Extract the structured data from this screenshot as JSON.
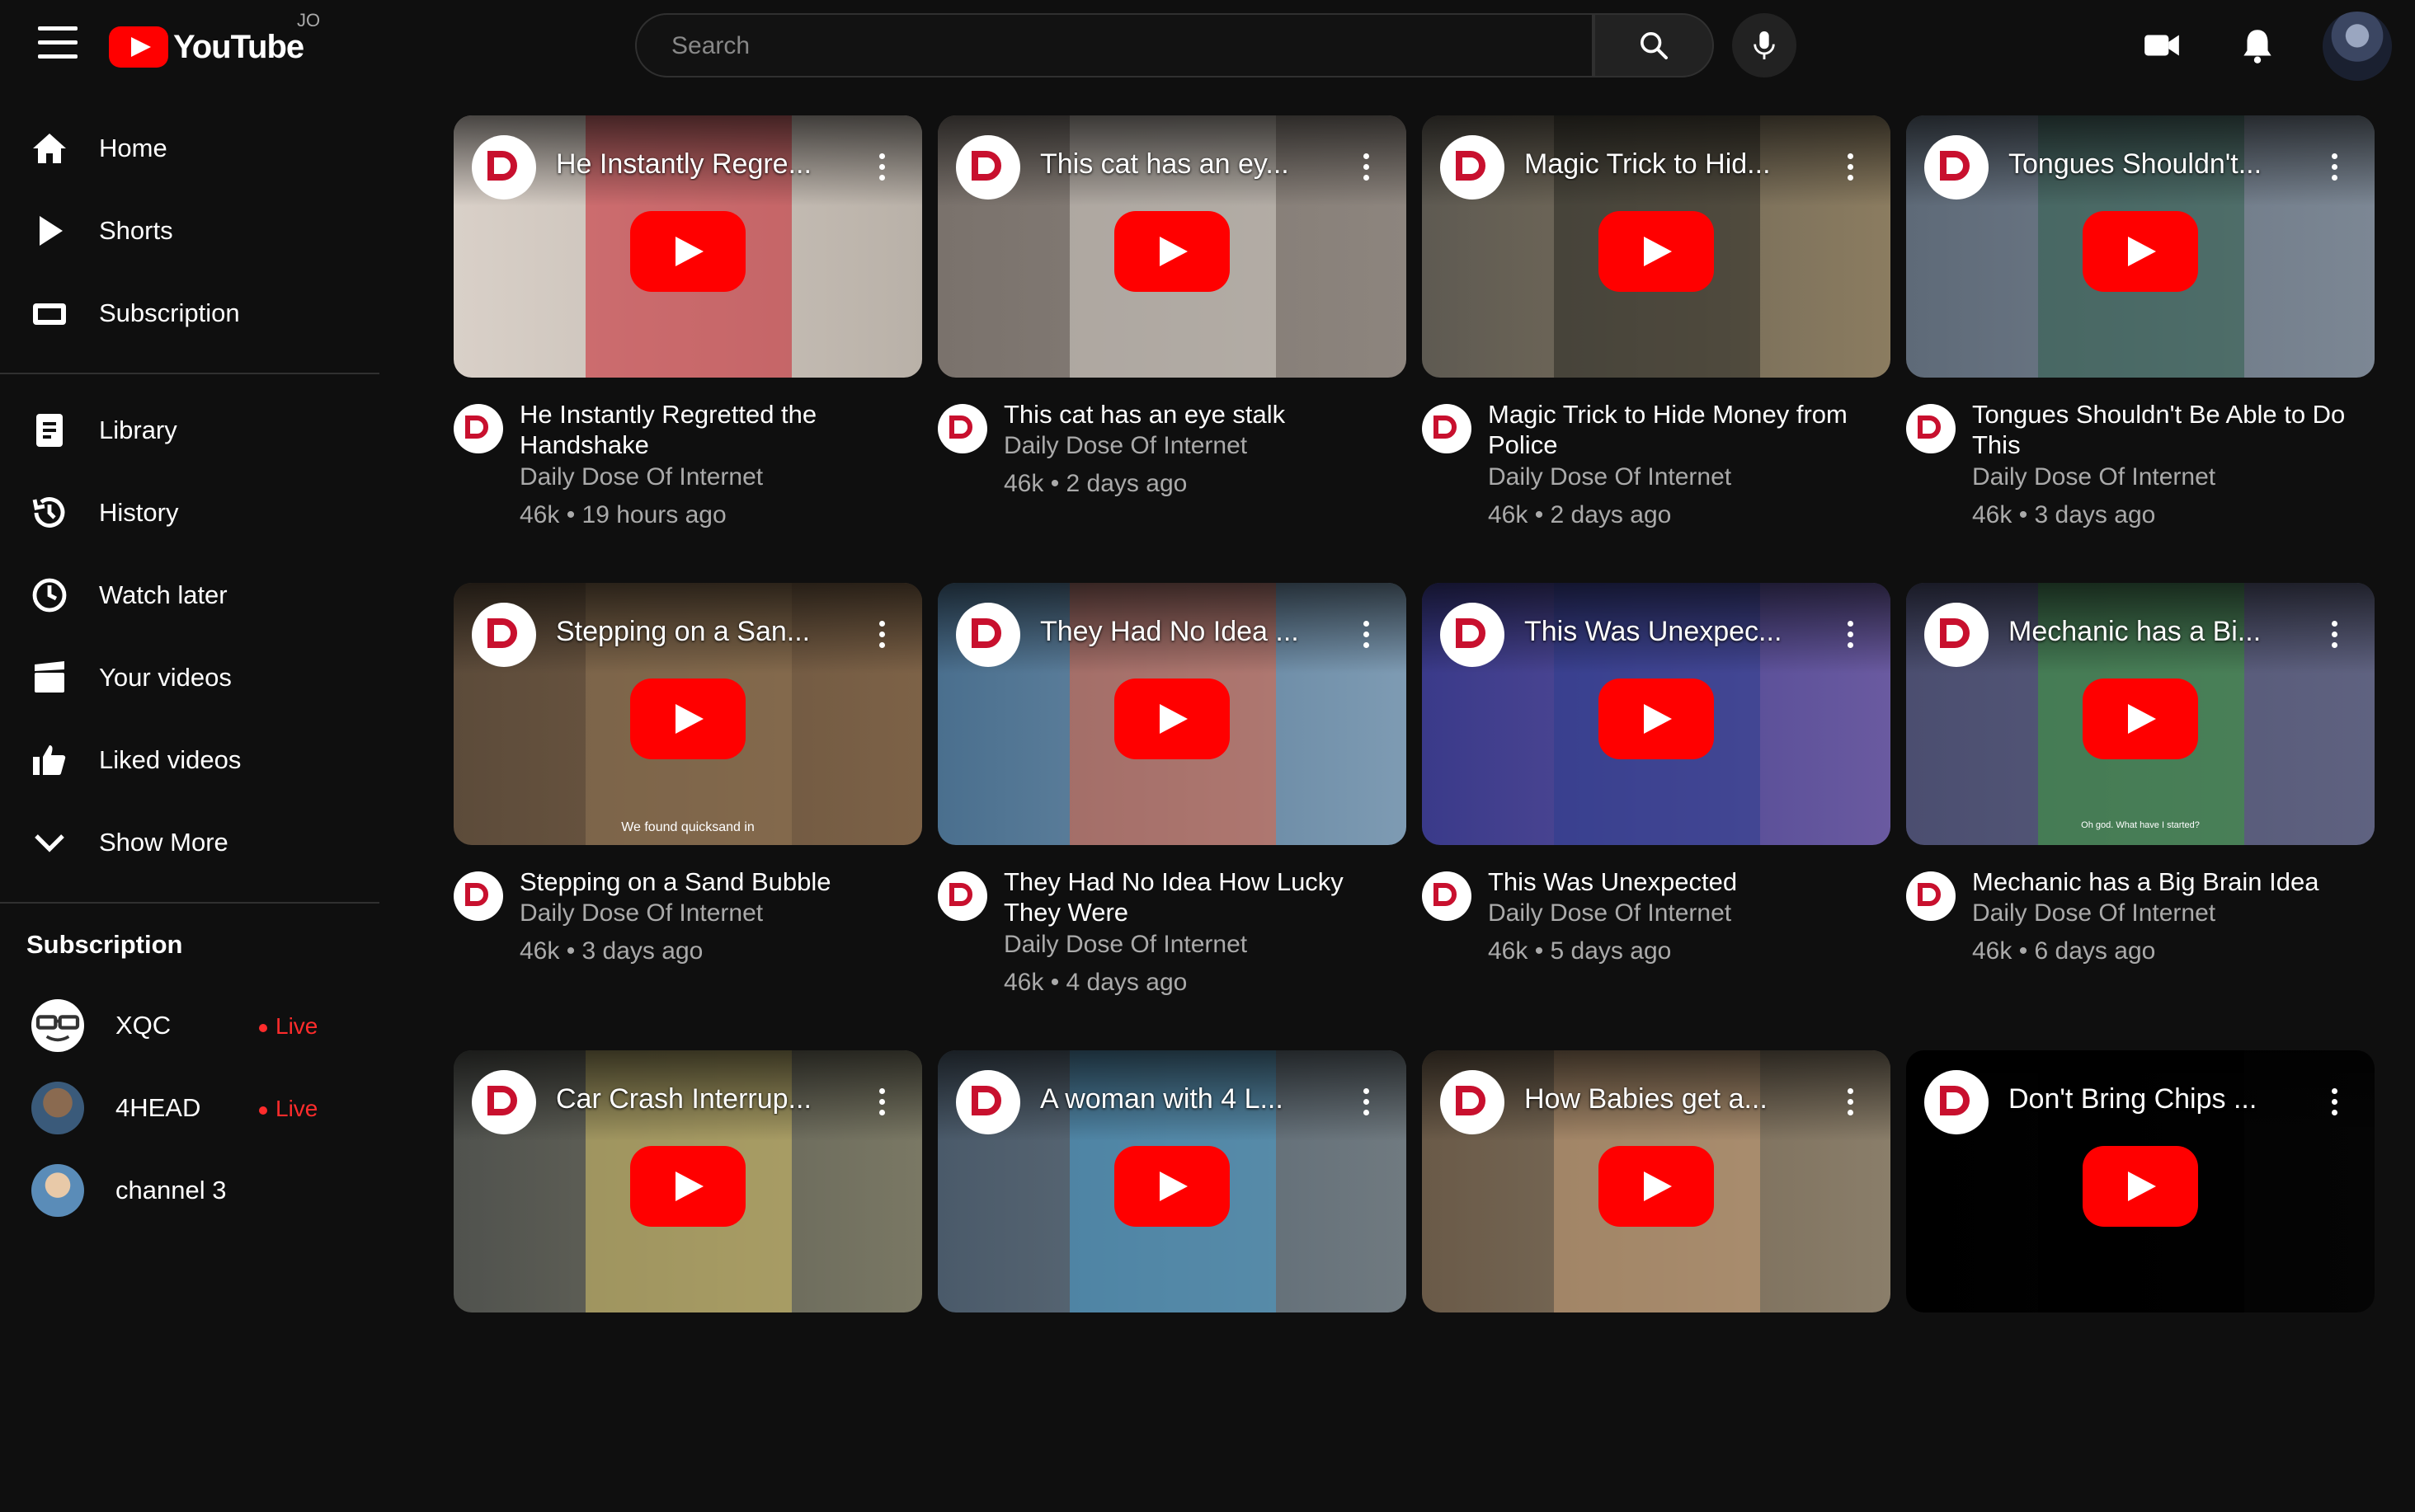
{
  "header": {
    "logo_text": "YouTube",
    "logo_sup": "JO",
    "search_placeholder": "Search"
  },
  "sidebar": {
    "items": [
      {
        "label": "Home"
      },
      {
        "label": "Shorts"
      },
      {
        "label": "Subscription"
      },
      {
        "label": "Library"
      },
      {
        "label": "History"
      },
      {
        "label": "Watch later"
      },
      {
        "label": "Your videos"
      },
      {
        "label": "Liked videos"
      },
      {
        "label": "Show More"
      }
    ],
    "subscription_heading": "Subscription",
    "channels": [
      {
        "name": "XQC",
        "status": "Live"
      },
      {
        "name": "4HEAD",
        "status": "Live"
      },
      {
        "name": "channel 3"
      }
    ]
  },
  "videos": [
    {
      "thumb_title": "He Instantly Regre...",
      "title": "He Instantly Regretted the Handshake",
      "channel": "Daily Dose Of Internet",
      "meta": "46k • 19 hours ago"
    },
    {
      "thumb_title": "This cat has an ey...",
      "title": "This cat has an eye stalk",
      "channel": "Daily Dose Of Internet",
      "meta": "46k • 2 days ago"
    },
    {
      "thumb_title": "Magic Trick to Hid...",
      "title": "Magic Trick to Hide Money from Police",
      "channel": "Daily Dose Of Internet",
      "meta": "46k • 2 days ago"
    },
    {
      "thumb_title": "Tongues Shouldn't...",
      "title": "Tongues Shouldn't Be Able to Do This",
      "channel": "Daily Dose Of Internet",
      "meta": "46k • 3 days ago"
    },
    {
      "thumb_title": "Stepping on a San...",
      "title": "Stepping on a Sand Bubble",
      "channel": "Daily Dose Of Internet",
      "meta": "46k • 3 days ago",
      "caption": "We found quicksand in"
    },
    {
      "thumb_title": "They Had No Idea ...",
      "title": "They Had No Idea How Lucky They Were",
      "channel": "Daily Dose Of Internet",
      "meta": "46k • 4 days ago"
    },
    {
      "thumb_title": "This Was Unexpec...",
      "title": "This Was Unexpected",
      "channel": "Daily Dose Of Internet",
      "meta": "46k • 5 days ago"
    },
    {
      "thumb_title": "Mechanic has a Bi...",
      "title": "Mechanic has a Big Brain Idea",
      "channel": "Daily Dose Of Internet",
      "meta": "46k • 6 days ago",
      "caption": "Oh god. What have I started?"
    },
    {
      "thumb_title": "Car Crash Interrup..."
    },
    {
      "thumb_title": "A woman with 4 L..."
    },
    {
      "thumb_title": "How Babies get a..."
    },
    {
      "thumb_title": "Don't Bring Chips ..."
    }
  ],
  "colors": {
    "background": "#0f0f0f",
    "accent": "#ff0000",
    "live": "#ff2c2c",
    "secondary_text": "#aaaaaa"
  }
}
